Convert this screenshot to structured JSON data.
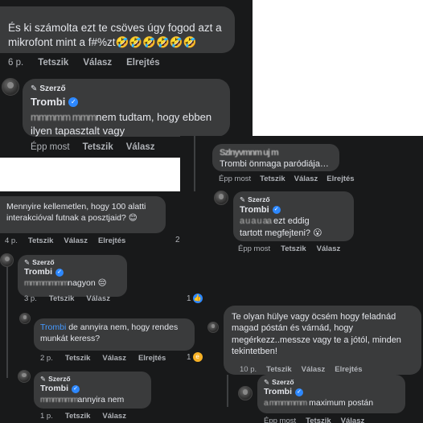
{
  "p1": {
    "comment_text": "És ki számolta ezt te csöves úgy fogod azt a mikrofont mint a f#%zt",
    "emojis": "🤣🤣🤣🤣🤣🤣",
    "time": "6 p.",
    "like": "Tetszik",
    "reply": "Válasz",
    "hide": "Elrejtés",
    "author_badge": "Szerző",
    "name": "Trombi",
    "reply_blur": "mmmmm mmm",
    "reply_text": "nem tudtam, hogy ebben ilyen tapasztalt vagy",
    "reply_time": "Épp most"
  },
  "p2": {
    "top_blur": "Szlnyvmnm uj m",
    "top_text": "Trombi önmaga paródiája…",
    "time": "Épp most",
    "like": "Tetszik",
    "reply": "Válasz",
    "hide": "Elrejtés",
    "author_badge": "Szerző",
    "name": "Trombi",
    "reply_blur": "a u a u aa",
    "reply_text1": "ezt eddig",
    "reply_text2": "tartott megfejteni?",
    "reply_emoji": "😮"
  },
  "p3": {
    "comment_text": "Mennyire kellemetlen, hogy 100 alatti interakcióval futnak a posztjaid?",
    "comment_emoji": "😊",
    "time": "4 p.",
    "like": "Tetszik",
    "reply": "Válasz",
    "hide": "Elrejtés",
    "edge_num": "2",
    "author_badge": "Szerző",
    "name": "Trombi",
    "reply1_blur": "mmmmmmm",
    "reply1_text": "nagyon",
    "reply1_emoji": "😔",
    "reply1_time": "3 p.",
    "reply1_react_count": "1",
    "reply2_mention": "Trombi",
    "reply2_text": "de annyira nem, hogy rendes munkát keress?",
    "reply2_time": "2 p.",
    "reply2_react_count": "1",
    "reply3_blur": "mmmmmm",
    "reply3_text": "annyira nem",
    "reply3_time": "1 p."
  },
  "p4": {
    "comment_text": "Te olyan hülye vagy öcsém hogy feladnád magad póstán és várnád, hogy megérkezz..messze vagy te a jótól, minden tekintetben!",
    "time": "10 p.",
    "like": "Tetszik",
    "reply": "Válasz",
    "hide": "Elrejtés",
    "author_badge": "Szerző",
    "name": "Trombi",
    "reply_blur": "a mmmmmm",
    "reply_text": "maximum postán",
    "reply_time": "Épp most"
  },
  "colors": {
    "background": "#18191a",
    "bubble": "#3a3b3c",
    "text": "#e4e6eb",
    "meta": "#b0b3b8",
    "verified": "#2d88ff",
    "mention": "#4599ff"
  }
}
